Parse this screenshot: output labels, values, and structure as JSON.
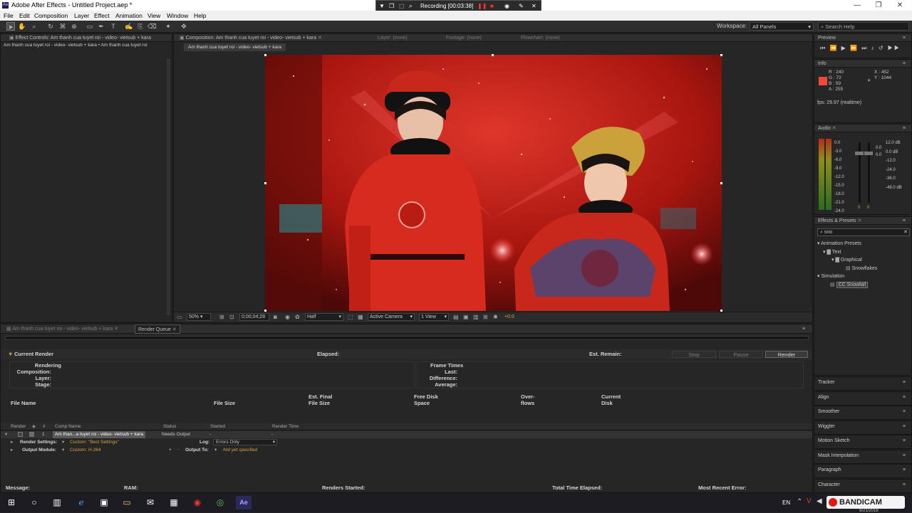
{
  "window": {
    "title": "Adobe After Effects - Untitled Project.aep *",
    "logo": "Ae",
    "controls": [
      "—",
      "❐",
      "✕"
    ]
  },
  "recorder": {
    "label": "Recording [00:03:38]"
  },
  "menu": [
    "File",
    "Edit",
    "Composition",
    "Layer",
    "Effect",
    "Animation",
    "View",
    "Window",
    "Help"
  ],
  "toolbar": {
    "workspace_label": "Workspace:",
    "workspace_value": "All Panels",
    "search_placeholder": "Search Help"
  },
  "effect_controls": {
    "tab": "Effect Controls: Am thanh cua tuyet roi - video- vietsub + kara",
    "subtitle": "Am thanh cua tuyet roi - video- vietsub + kara • Am thanh cua tuyet roi"
  },
  "composition": {
    "tab": "Composition: Am thanh cua tuyet roi - video- vietsub + kara",
    "layer_tab": "Layer: (none)",
    "footage_tab": "Footage: (none)",
    "flowchart_tab": "Flowchart: (none)",
    "comp_label": "Am thanh cua tuyet roi - video- vietsub + kara",
    "zoom": "50%",
    "timecode": "0;00;04;28",
    "resolution": "Half",
    "camera": "Active Camera",
    "view": "1 View",
    "exposure": "+0.0"
  },
  "preview": {
    "title": "Preview"
  },
  "info": {
    "title": "Info",
    "r": "R : 240",
    "g": "G : 72",
    "b": "B : 59",
    "a": "A : 255",
    "x": "X : 452",
    "y": "Y : 1044",
    "fps": "fps: 29.97 (realtime)",
    "swatch": "#f0483b"
  },
  "audio": {
    "title": "Audio",
    "left_scale": [
      "0.0",
      "-3.0",
      "-6.0",
      "-9.0",
      "-12.0",
      "-15.0",
      "-18.0",
      "-21.0",
      "-24.0"
    ],
    "right_scale": [
      "12.0 dB",
      "0.0 dB",
      "-12.0",
      "-24.0",
      "-36.0",
      "-48.0 dB"
    ],
    "left_value": "0.0",
    "right_value": "0.0",
    "knob_left": "0",
    "knob_right": "0"
  },
  "effects": {
    "title": "Effects & Presets",
    "search": "sno",
    "tree": [
      {
        "label": "Animation Presets",
        "indent": 0
      },
      {
        "label": "Text",
        "indent": 1
      },
      {
        "label": "Graphical",
        "indent": 2
      },
      {
        "label": "Snowflakes",
        "indent": 3
      },
      {
        "label": "Simulation",
        "indent": 0
      },
      {
        "label": "CC Snowfall",
        "indent": 1
      }
    ]
  },
  "side_panels": [
    "Tracker",
    "Align",
    "Smoother",
    "Wiggler",
    "Motion Sketch",
    "Mask Interpolation",
    "Paragraph",
    "Character"
  ],
  "render": {
    "tab1": "Am thanh cua tuyet roi - video- vietsub + kara",
    "tab2": "Render Queue",
    "current_render": "Current Render",
    "elapsed": "Elapsed:",
    "est_remain": "Est. Remain:",
    "stop": "Stop",
    "pause": "Pause",
    "render_btn": "Render",
    "rendering": "Rendering",
    "composition": "Composition:",
    "layer": "Layer:",
    "stage": "Stage:",
    "frame_times": "Frame Times",
    "last": "Last:",
    "difference": "Difference:",
    "average": "Average:",
    "file_name": "File Name",
    "file_size": "File Size",
    "est_final": "Est. Final",
    "file_size2": "File Size",
    "free_disk": "Free Disk",
    "space": "Space",
    "over": "Over-",
    "flows": "flows",
    "current": "Current",
    "disk": "Disk",
    "col_render": "Render",
    "col_num": "#",
    "col_comp": "Comp Name",
    "col_status": "Status",
    "col_started": "Started",
    "col_time": "Render Time",
    "row_num": "1",
    "row_comp": "Am than...a tuyet roi - video- vietsub + kara",
    "row_status": "Needs Output",
    "row_dash1": "-",
    "row_dash2": "-",
    "rs_label": "Render Settings:",
    "rs_value": "Custom: \"Best Settings\"",
    "log_label": "Log:",
    "log_value": "Errors Only",
    "om_label": "Output Module:",
    "om_value": "Custom: H.264",
    "out_label": "Output To:",
    "out_value": "Not yet specified",
    "message": "Message:",
    "ram": "RAM:",
    "started": "Renders Started:",
    "total": "Total Time Elapsed:",
    "recent": "Most Recent Error:"
  },
  "taskbar": {
    "lang": "EN",
    "time": "9/21/2018",
    "bandicam": "BANDICAM"
  }
}
